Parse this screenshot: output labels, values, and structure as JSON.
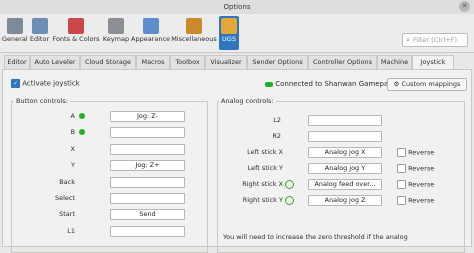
{
  "window": {
    "title": "Options",
    "close_symbol": "✕"
  },
  "toolbar": {
    "items": [
      {
        "label": "General",
        "icon": "gear-icon",
        "color": "#7d8a97"
      },
      {
        "label": "Editor",
        "icon": "editor-icon",
        "color": "#6c8db5"
      },
      {
        "label": "Fonts & Colors",
        "icon": "fonts-colors-icon",
        "color": "#cc4747"
      },
      {
        "label": "Keymap",
        "icon": "keyboard-icon",
        "color": "#8b8f95"
      },
      {
        "label": "Appearance",
        "icon": "appearance-icon",
        "color": "#5d8fcf"
      },
      {
        "label": "Miscellaneous",
        "icon": "misc-icon",
        "color": "#cc8a2c"
      },
      {
        "label": "UGS",
        "icon": "ugs-icon",
        "color": "#e6a73a"
      }
    ],
    "selected": "UGS",
    "filter_placeholder": "Filter (Ctrl+F)"
  },
  "tabs": [
    "Editor",
    "Auto Leveler",
    "Cloud Storage",
    "Macros",
    "Toolbox",
    "Visualizer",
    "Sender Options",
    "Controller Options",
    "Machine",
    "Joystick"
  ],
  "active_tab": "Joystick",
  "joystick": {
    "activate_label": "Activate joystick",
    "connected_label": "Connected to Shanwan Gamepad",
    "custom_mappings_label": "Custom mappings",
    "button_controls_title": "Button controls:",
    "analog_controls_title": "Analog controls:",
    "buttons": [
      {
        "label": "A",
        "led": true,
        "value": "Jog: Z-"
      },
      {
        "label": "B",
        "led": true,
        "value": ""
      },
      {
        "label": "X",
        "led": false,
        "value": ""
      },
      {
        "label": "Y",
        "led": false,
        "value": "Jog: Z+"
      },
      {
        "label": "Back",
        "led": false,
        "value": ""
      },
      {
        "label": "Select",
        "led": false,
        "value": ""
      },
      {
        "label": "Start",
        "led": false,
        "value": "Send"
      },
      {
        "label": "L1",
        "led": false,
        "value": ""
      }
    ],
    "analog": [
      {
        "label": "L2",
        "value": "",
        "reverse": null
      },
      {
        "label": "R2",
        "value": "",
        "reverse": null
      },
      {
        "label": "Left stick X",
        "value": "Analog jog X",
        "reverse": "Reverse"
      },
      {
        "label": "Left stick Y",
        "value": "Analog jog Y",
        "reverse": "Reverse"
      },
      {
        "label": "Right stick X",
        "value": "Analog feed over...",
        "reverse": "Reverse"
      },
      {
        "label": "Right stick Y",
        "value": "Analog jog Z",
        "reverse": "Reverse"
      }
    ],
    "zero_threshold_note": "You will need to increase the zero threshold if the analog"
  }
}
